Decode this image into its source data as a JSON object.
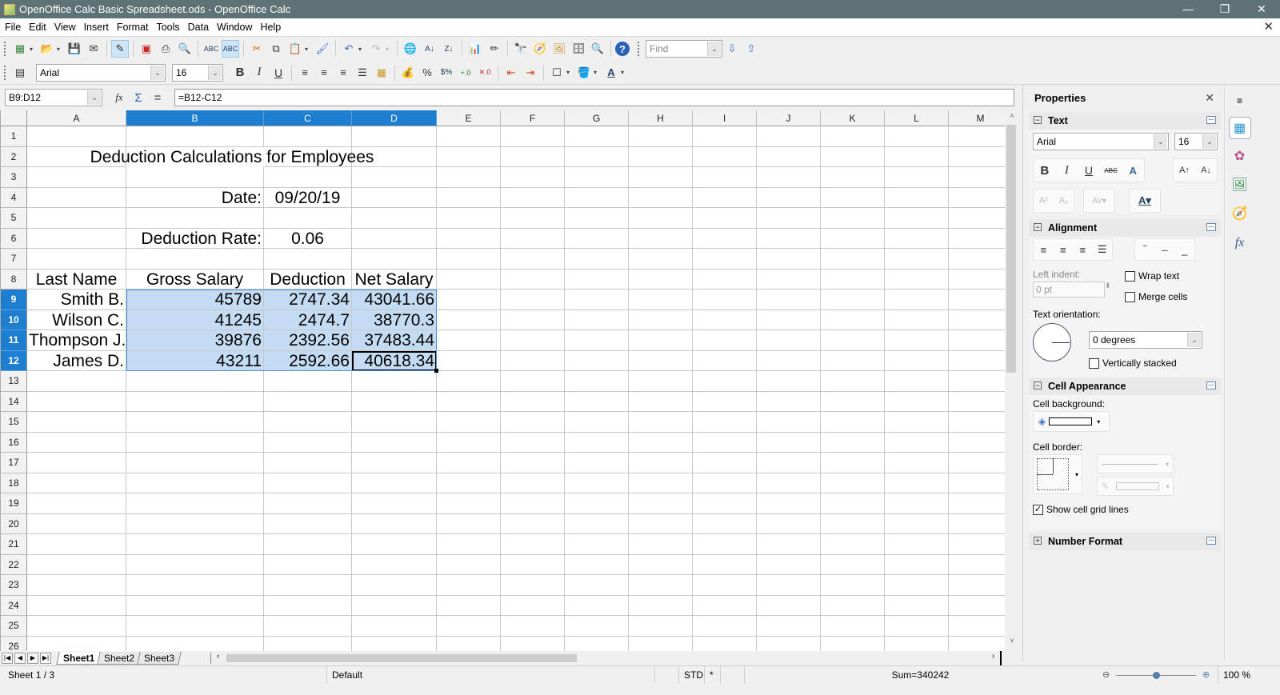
{
  "window": {
    "title": "OpenOffice Calc Basic Spreadsheet.ods - OpenOffice Calc",
    "controls": {
      "minimize": "—",
      "restore": "❐",
      "close": "✕"
    }
  },
  "menu": [
    "File",
    "Edit",
    "View",
    "Insert",
    "Format",
    "Tools",
    "Data",
    "Window",
    "Help"
  ],
  "toolbar": {
    "find_placeholder": "Find",
    "font_name": "Arial",
    "font_size": "16"
  },
  "formula_bar": {
    "name_box": "B9:D12",
    "formula": "=B12-C12"
  },
  "columns": [
    "A",
    "B",
    "C",
    "D",
    "E",
    "F",
    "G",
    "H",
    "I",
    "J",
    "K",
    "L",
    "M"
  ],
  "selected_columns": [
    "B",
    "C",
    "D"
  ],
  "rows": [
    "1",
    "2",
    "3",
    "4",
    "5",
    "6",
    "7",
    "8",
    "9",
    "10",
    "11",
    "12",
    "13",
    "14",
    "15",
    "16",
    "17",
    "18",
    "19",
    "20",
    "21",
    "22",
    "23",
    "24",
    "25",
    "26"
  ],
  "selected_rows": [
    "9",
    "10",
    "11",
    "12"
  ],
  "sheet": {
    "title": "Deduction Calculations for Employees",
    "date_label": "Date:",
    "date_value": "09/20/19",
    "rate_label": "Deduction Rate:",
    "rate_value": "0.06",
    "headers": [
      "Last Name",
      "Gross Salary",
      "Deduction",
      "Net Salary"
    ],
    "data": [
      [
        "Smith B.",
        "45789",
        "2747.34",
        "43041.66"
      ],
      [
        "Wilson C.",
        "41245",
        "2474.7",
        "38770.3"
      ],
      [
        "Thompson J.",
        "39876",
        "2392.56",
        "37483.44"
      ],
      [
        "James D.",
        "43211",
        "2592.66",
        "40618.34"
      ]
    ]
  },
  "sheet_tabs": [
    "Sheet1",
    "Sheet2",
    "Sheet3"
  ],
  "active_tab": "Sheet1",
  "status": {
    "sheet_pos": "Sheet 1 / 3",
    "page_style": "Default",
    "mode": "STD",
    "modified": "*",
    "sum": "Sum=340242",
    "zoom": "100 %",
    "zoom_fraction": 0.5
  },
  "sidebar": {
    "title": "Properties",
    "text_section": {
      "title": "Text",
      "font": "Arial",
      "size": "16"
    },
    "alignment_section": {
      "title": "Alignment",
      "left_indent_label": "Left indent:",
      "left_indent_value": "0 pt",
      "wrap_text": "Wrap text",
      "merge_cells": "Merge cells",
      "orientation_label": "Text orientation:",
      "orientation_value": "0 degrees",
      "vertically_stacked": "Vertically stacked"
    },
    "cell_appearance_section": {
      "title": "Cell Appearance",
      "background_label": "Cell background:",
      "border_label": "Cell border:",
      "show_grid": "Show cell grid lines",
      "show_grid_checked": true
    },
    "number_format_section": {
      "title": "Number Format"
    }
  }
}
